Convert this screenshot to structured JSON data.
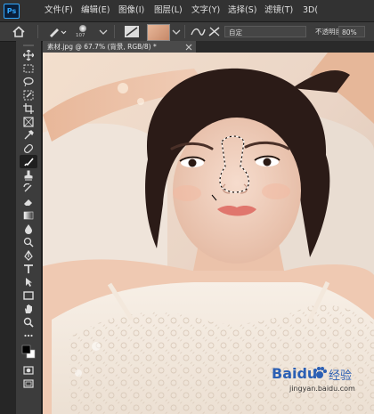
{
  "app": {
    "logo_text": "Ps"
  },
  "menus": [
    "文件(F)",
    "编辑(E)",
    "图像(I)",
    "图层(L)",
    "文字(Y)",
    "选择(S)",
    "滤镜(T)",
    "3D("
  ],
  "options": {
    "brush_size": "107",
    "mode_value": "自定",
    "opacity_label": "不透明度:",
    "opacity_value": "80%"
  },
  "document": {
    "tab_title": "素材.jpg @ 67.7% (背景, RGB/8) *"
  },
  "tools": [
    "move-tool",
    "marquee-tool",
    "lasso-tool",
    "quick-select-tool",
    "crop-tool",
    "frame-tool",
    "eyedropper-tool",
    "healing-brush-tool",
    "brush-tool",
    "clone-stamp-tool",
    "history-brush-tool",
    "eraser-tool",
    "gradient-tool",
    "blur-tool",
    "dodge-tool",
    "pen-tool",
    "type-tool",
    "path-select-tool",
    "rectangle-tool",
    "hand-tool",
    "zoom-tool",
    "more-tools",
    "color-swatches",
    "quick-mask",
    "screen-mode"
  ],
  "watermark": {
    "brand": "Baidu",
    "label": "经验",
    "url": "jingyan.baidu.com"
  },
  "colors": {
    "menubar": "#323232",
    "options": "#3c3c3c",
    "toolbar": "#3c3c3c",
    "accent": "#31a8ff"
  }
}
